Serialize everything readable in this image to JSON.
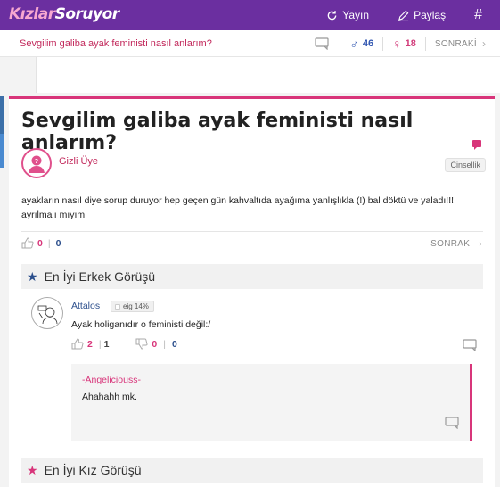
{
  "header": {
    "logo_part1": "Kızlar",
    "logo_part2": "Soruyor",
    "publish_label": "Yayın",
    "share_label": "Paylaş",
    "hash_label": "#"
  },
  "subbar": {
    "title": "Sevgilim galiba ayak feministi nasıl anlarım?",
    "male_count": "46",
    "female_count": "18",
    "next_label": "SONRAKİ"
  },
  "question": {
    "title": "Sevgilim galiba ayak feministi nasıl anlarım?",
    "user": "Gizli Üye",
    "category": "Cinsellik",
    "body": "ayakların nasıl diye sorup duruyor hep geçen gün kahvaltıda ayağıma yanlışlıkla (!) bal döktü ve yaladı!!! ayrılmalı mıyım",
    "votes_up": "0",
    "votes_down": "0",
    "next_label": "SONRAKİ"
  },
  "best_male": {
    "heading": "En İyi Erkek Görüşü",
    "user": "Attalos",
    "badge": "eig 14%",
    "text": "Ayak holiganıdır o feministi değil:/",
    "up_votes": "2",
    "up_separator_count": "1",
    "down_votes": "0",
    "down_separator_count": "0",
    "reply_user": "-Angeliciouss-",
    "reply_text": "Ahahahh mk."
  },
  "best_female": {
    "heading": "En İyi Kız Görüşü"
  },
  "colors": {
    "topbar": "#6b2fa0",
    "accent_pink": "#d8357a",
    "male_blue": "#2f55b0"
  }
}
